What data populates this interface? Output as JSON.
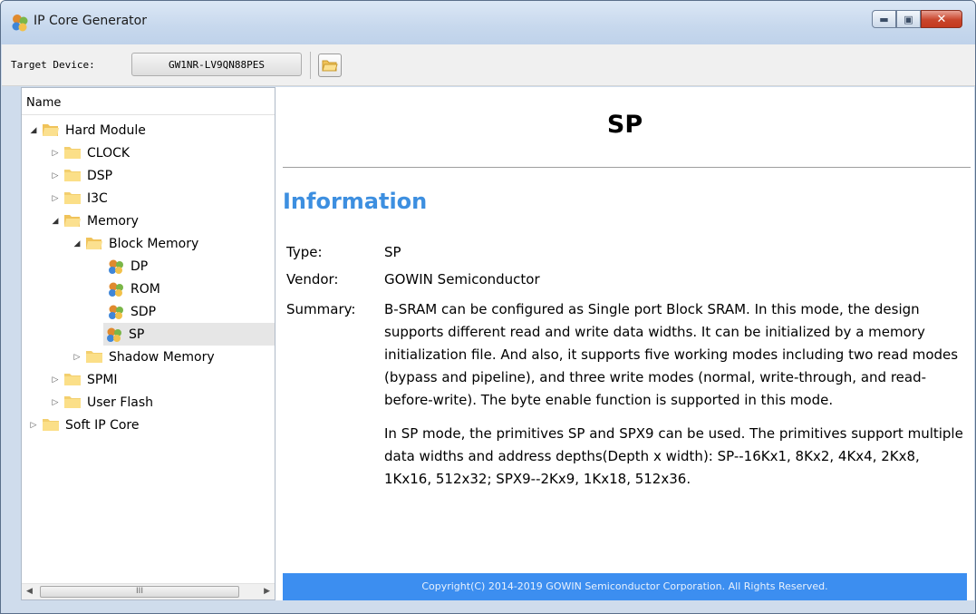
{
  "window": {
    "title": "IP Core Generator",
    "controls": {
      "minimize": "▬",
      "maximize": "▣",
      "close": "✕"
    }
  },
  "toolbar": {
    "target_label": "Target Device:",
    "device": "GW1NR-LV9QN88PES",
    "open_icon": "folder-open-icon"
  },
  "tree": {
    "header": "Name",
    "items": [
      {
        "label": "Hard Module",
        "level": 0,
        "expanded": true,
        "icon": "folder-open-icon"
      },
      {
        "label": "CLOCK",
        "level": 1,
        "expanded": false,
        "icon": "folder-icon"
      },
      {
        "label": "DSP",
        "level": 1,
        "expanded": false,
        "icon": "folder-icon"
      },
      {
        "label": "I3C",
        "level": 1,
        "expanded": false,
        "icon": "folder-icon"
      },
      {
        "label": "Memory",
        "level": 1,
        "expanded": true,
        "icon": "folder-open-icon"
      },
      {
        "label": "Block Memory",
        "level": 2,
        "expanded": true,
        "icon": "folder-open-icon"
      },
      {
        "label": "DP",
        "level": 3,
        "icon": "ip-core-icon"
      },
      {
        "label": "ROM",
        "level": 3,
        "icon": "ip-core-icon"
      },
      {
        "label": "SDP",
        "level": 3,
        "icon": "ip-core-icon"
      },
      {
        "label": "SP",
        "level": 3,
        "icon": "ip-core-icon",
        "selected": true
      },
      {
        "label": "Shadow Memory",
        "level": 2,
        "expanded": false,
        "icon": "folder-icon"
      },
      {
        "label": "SPMI",
        "level": 1,
        "expanded": false,
        "icon": "folder-icon"
      },
      {
        "label": "User Flash",
        "level": 1,
        "expanded": false,
        "icon": "folder-icon"
      },
      {
        "label": "Soft IP Core",
        "level": 0,
        "expanded": false,
        "icon": "folder-icon"
      }
    ],
    "scroll_grip": "III"
  },
  "content": {
    "title": "SP",
    "section": "Information",
    "type_label": "Type:",
    "type_value": "SP",
    "vendor_label": "Vendor:",
    "vendor_value": "GOWIN Semiconductor",
    "summary_label": "Summary:",
    "summary_p1": "B-SRAM can be configured as Single port Block SRAM. In this mode, the design supports different read and write data widths. It can be initialized by a memory initialization file. And also, it supports five working modes including two read modes (bypass and pipeline), and three write modes (normal, write-through, and read-before-write). The byte enable function is supported in this mode.",
    "summary_p2": "In SP mode, the primitives SP and SPX9 can be used. The primitives support multiple data widths and address depths(Depth x width): SP--16Kx1, 8Kx2, 4Kx4, 2Kx8, 1Kx16, 512x32; SPX9--2Kx9, 1Kx18, 512x36.",
    "footer": "Copyright(C) 2014-2019 GOWIN Semiconductor Corporation. All Rights Reserved."
  },
  "colors": {
    "accent": "#3d8fe0",
    "footer_bg": "#3c8ef0",
    "folder": "#f5d27a"
  }
}
